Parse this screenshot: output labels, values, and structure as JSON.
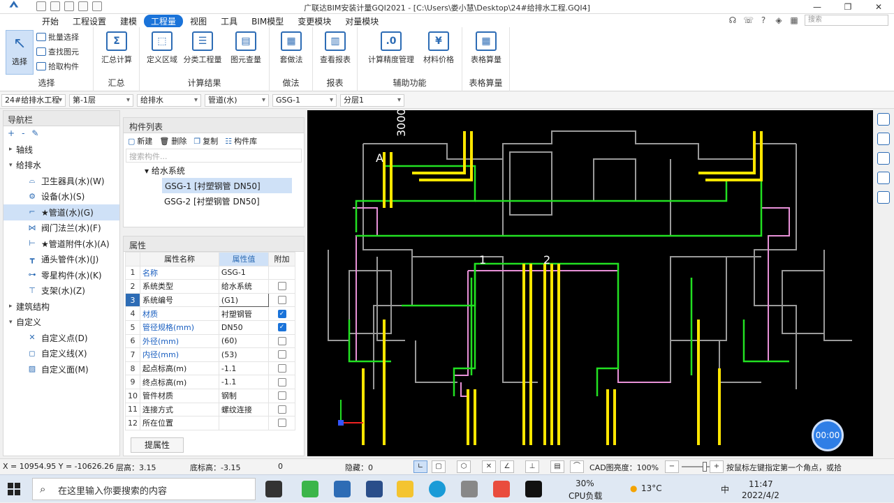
{
  "window": {
    "title": "广联达BIM安装计量GQI2021 - [C:\\Users\\娄小慧\\Desktop\\24#给排水工程.GQI4]",
    "controls": [
      "—",
      "❐",
      "✕"
    ]
  },
  "menu": {
    "items": [
      "开始",
      "工程设置",
      "建模",
      "工程量",
      "视图",
      "工具",
      "BIM模型",
      "变更模块",
      "对量模块"
    ],
    "active_index": 3,
    "search_placeholder": "搜索"
  },
  "ribbon": {
    "select_group": {
      "select_label": "选择",
      "batch_select": "批量选择",
      "find_element": "查找图元",
      "pick_component": "拾取构件",
      "group_label": "选择"
    },
    "summary_group": {
      "calc": "汇总计算",
      "group_label": "汇总"
    },
    "results_group": {
      "define_area": "定义区域",
      "classified": "分类工程量",
      "element_qty": "图元查量",
      "group_label": "计算结果"
    },
    "method_group": {
      "apply_method": "套做法",
      "group_label": "做法"
    },
    "report_group": {
      "view_report": "查看报表",
      "group_label": "报表"
    },
    "aux_group": {
      "precision": "计算精度管理",
      "material_price": "材料价格",
      "group_label": "辅助功能"
    },
    "table_group": {
      "table_calc": "表格算量",
      "group_label": "表格算量"
    }
  },
  "combos": [
    "24#给排水工程",
    "第-1层",
    "给排水",
    "管道(水)",
    "GSG-1",
    "分层1"
  ],
  "nav": {
    "title": "导航栏",
    "items": [
      {
        "label": "轴线",
        "level": 0,
        "twisty": "▸"
      },
      {
        "label": "给排水",
        "level": 0,
        "twisty": "▾"
      },
      {
        "label": "卫生器具(水)(W)",
        "level": 1,
        "icon": "sanitary-icon"
      },
      {
        "label": "设备(水)(S)",
        "level": 1,
        "icon": "equipment-icon"
      },
      {
        "label": "★管道(水)(G)",
        "level": 1,
        "icon": "pipe-icon",
        "selected": true
      },
      {
        "label": "阀门法兰(水)(F)",
        "level": 1,
        "icon": "valve-icon"
      },
      {
        "label": "★管道附件(水)(A)",
        "level": 1,
        "icon": "pipe-accessory-icon"
      },
      {
        "label": "通头管件(水)(J)",
        "level": 1,
        "icon": "fitting-icon"
      },
      {
        "label": "零星构件(水)(K)",
        "level": 1,
        "icon": "misc-component-icon"
      },
      {
        "label": "支架(水)(Z)",
        "level": 1,
        "icon": "bracket-icon"
      },
      {
        "label": "建筑结构",
        "level": 0,
        "twisty": "▸"
      },
      {
        "label": "自定义",
        "level": 0,
        "twisty": "▾"
      },
      {
        "label": "自定义点(D)",
        "level": 1,
        "icon": "custom-point-icon"
      },
      {
        "label": "自定义线(X)",
        "level": 1,
        "icon": "custom-line-icon"
      },
      {
        "label": "自定义面(M)",
        "level": 1,
        "icon": "custom-face-icon"
      }
    ]
  },
  "component_list": {
    "title": "构件列表",
    "tools": [
      "新建",
      "删除",
      "复制",
      "构件库"
    ],
    "search_placeholder": "搜索构件...",
    "system": "给水系统",
    "items": [
      "GSG-1 [衬塑钢管 DN50]",
      "GSG-2 [衬塑钢管 DN50]"
    ],
    "selected_index": 0
  },
  "properties": {
    "title": "属性",
    "headers": [
      "属性名称",
      "属性值",
      "附加"
    ],
    "rows": [
      {
        "n": "1",
        "name": "名称",
        "value": "GSG-1",
        "blue": true,
        "check": null
      },
      {
        "n": "2",
        "name": "系统类型",
        "value": "给水系统",
        "blue": false,
        "check": false
      },
      {
        "n": "3",
        "name": "系统编号",
        "value": "(G1)",
        "blue": false,
        "check": false,
        "editing": true
      },
      {
        "n": "4",
        "name": "材质",
        "value": "衬塑钢管",
        "blue": true,
        "check": true
      },
      {
        "n": "5",
        "name": "管径规格(mm)",
        "value": "DN50",
        "blue": true,
        "check": true
      },
      {
        "n": "6",
        "name": "外径(mm)",
        "value": "(60)",
        "blue": true,
        "check": false
      },
      {
        "n": "7",
        "name": "内径(mm)",
        "value": "(53)",
        "blue": true,
        "check": false
      },
      {
        "n": "8",
        "name": "起点标高(m)",
        "value": "-1.1",
        "blue": false,
        "check": false
      },
      {
        "n": "9",
        "name": "终点标高(m)",
        "value": "-1.1",
        "blue": false,
        "check": false
      },
      {
        "n": "10",
        "name": "管件材质",
        "value": "钢制",
        "blue": false,
        "check": false
      },
      {
        "n": "11",
        "name": "连接方式",
        "value": "螺纹连接",
        "blue": false,
        "check": false
      },
      {
        "n": "12",
        "name": "所在位置",
        "value": "",
        "blue": false,
        "check": false
      }
    ],
    "extract_button": "提属性"
  },
  "canvas": {
    "dim_label": "3000",
    "markers": [
      "A",
      "1",
      "2"
    ]
  },
  "timer": "00:00",
  "status": {
    "coords": "X = 10954.95 Y = -10626.26",
    "floor_height": "层高：3.15",
    "base_height": "底标高：-3.15",
    "zero": "0",
    "hidden": "隐藏：0",
    "cad_brightness": "CAD图亮度：100%",
    "hint": "按鼠标左键指定第一个角点，或拾"
  },
  "taskbar": {
    "search_placeholder": "在这里输入你要搜索的内容",
    "cpu_percent": "30%",
    "cpu_label": "CPU负载",
    "temperature": "13°C",
    "ime": "中",
    "time": "11:47",
    "date": "2022/4/2"
  }
}
